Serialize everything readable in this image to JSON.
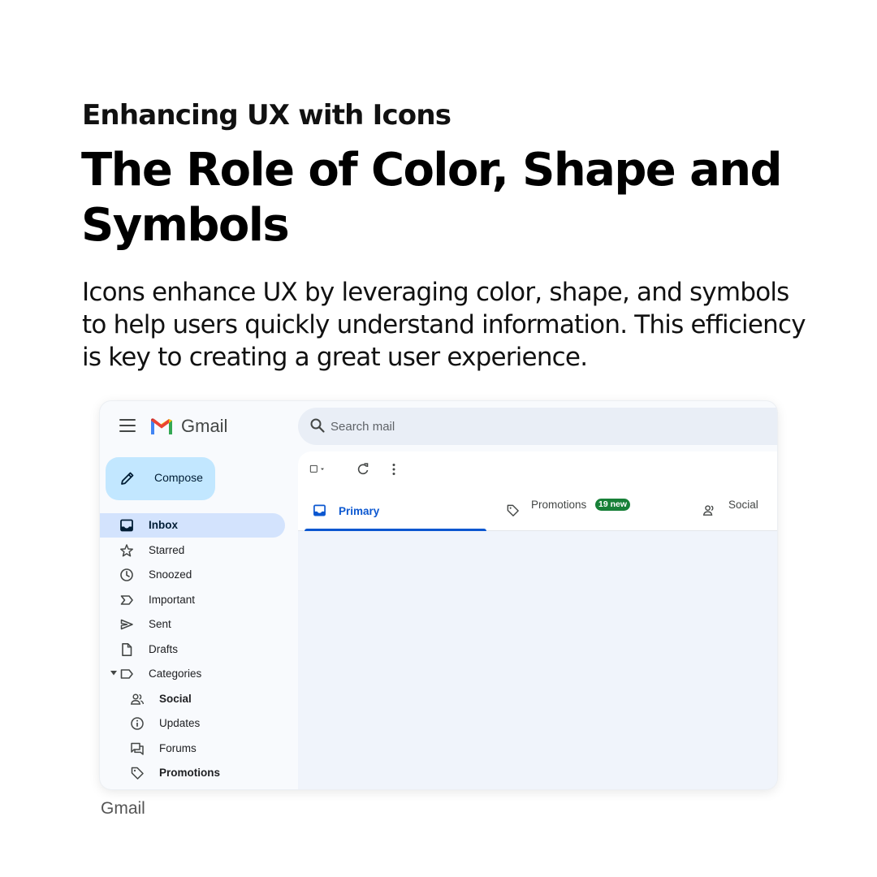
{
  "page": {
    "eyebrow": "Enhancing UX with Icons",
    "headline": "The Role of Color, Shape and Symbols",
    "body": "Icons enhance UX by leveraging color, shape, and symbols to help users quickly understand information. This efficiency is key to creating a great user experience.",
    "caption": "Gmail"
  },
  "gmail": {
    "app_name": "Gmail",
    "search": {
      "placeholder": "Search mail"
    },
    "compose_label": "Compose",
    "nav": {
      "inbox": "Inbox",
      "starred": "Starred",
      "snoozed": "Snoozed",
      "important": "Important",
      "sent": "Sent",
      "drafts": "Drafts",
      "categories": "Categories",
      "social": "Social",
      "updates": "Updates",
      "forums": "Forums",
      "promotions": "Promotions"
    },
    "tabs": {
      "primary": "Primary",
      "promotions": "Promotions",
      "promotions_badge": "19 new",
      "social": "Social"
    },
    "colors": {
      "compose_bg": "#c2e7ff",
      "active_nav_bg": "#d3e3fd",
      "accent_blue": "#0b57d0",
      "badge_green": "#188038",
      "search_bg": "#e9eef6"
    },
    "icons": [
      "menu-icon",
      "gmail-logo-icon",
      "search-icon",
      "pencil-icon",
      "inbox-icon",
      "star-icon",
      "clock-icon",
      "important-icon",
      "send-icon",
      "draft-icon",
      "label-icon",
      "people-icon",
      "info-icon",
      "forum-icon",
      "tag-icon",
      "checkbox-icon",
      "refresh-icon",
      "more-vert-icon"
    ]
  }
}
